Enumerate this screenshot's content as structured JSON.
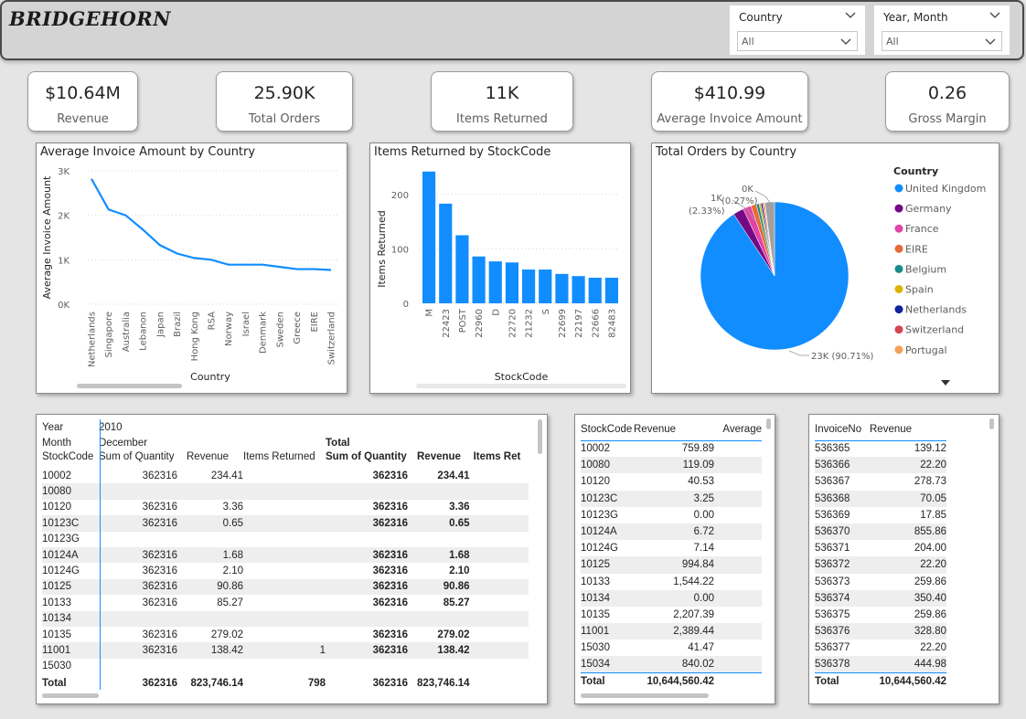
{
  "header": {
    "brand": "BRIDGEHORN",
    "slicers": [
      {
        "label": "Country",
        "value": "All"
      },
      {
        "label": "Year, Month",
        "value": "All"
      }
    ]
  },
  "kpis": [
    {
      "value": "$10.64M",
      "label": "Revenue"
    },
    {
      "value": "25.90K",
      "label": "Total Orders"
    },
    {
      "value": "11K",
      "label": "Items Returned"
    },
    {
      "value": "$410.99",
      "label": "Average Invoice Amount"
    },
    {
      "value": "0.26",
      "label": "Gross Margin"
    }
  ],
  "chart_data": [
    {
      "type": "line",
      "title": "Average Invoice Amount by Country",
      "xlabel": "Country",
      "ylabel": "Average Invoice Amount",
      "ylim": [
        0,
        3000
      ],
      "yticks": [
        "0K",
        "1K",
        "2K",
        "3K"
      ],
      "categories": [
        "Netherlands",
        "Singapore",
        "Australia",
        "Lebanon",
        "Japan",
        "Brazil",
        "Hong Kong",
        "RSA",
        "Norway",
        "Israel",
        "Denmark",
        "Sweden",
        "Greece",
        "EIRE",
        "Switzerland"
      ],
      "values": [
        2820,
        2130,
        2000,
        1680,
        1330,
        1140,
        1040,
        1000,
        890,
        890,
        890,
        840,
        790,
        790,
        770
      ],
      "color": "#118dff"
    },
    {
      "type": "bar",
      "title": "Items Returned by StockCode",
      "xlabel": "StockCode",
      "ylabel": "Items Returned",
      "ylim": [
        0,
        250
      ],
      "yticks": [
        0,
        100,
        200
      ],
      "categories": [
        "M",
        "22423",
        "POST",
        "22960",
        "D",
        "22720",
        "21232",
        "S",
        "22699",
        "22197",
        "22666",
        "82483"
      ],
      "values": [
        242,
        183,
        125,
        86,
        77,
        75,
        62,
        62,
        54,
        50,
        47,
        47
      ],
      "color": "#118dff"
    },
    {
      "type": "pie",
      "title": "Total Orders by Country",
      "legend_title": "Country",
      "legend": [
        {
          "name": "United Kingdom",
          "color": "#118dff"
        },
        {
          "name": "Germany",
          "color": "#750985"
        },
        {
          "name": "France",
          "color": "#e044a7"
        },
        {
          "name": "EIRE",
          "color": "#e66c37"
        },
        {
          "name": "Belgium",
          "color": "#1a8a8a"
        },
        {
          "name": "Spain",
          "color": "#d9b300"
        },
        {
          "name": "Netherlands",
          "color": "#12239e"
        },
        {
          "name": "Switzerland",
          "color": "#d64550"
        },
        {
          "name": "Portugal",
          "color": "#f5a05a"
        }
      ],
      "slices": [
        {
          "name": "United Kingdom",
          "percent": 90.71,
          "color": "#118dff"
        },
        {
          "name": "Germany",
          "percent": 2.33,
          "color": "#750985"
        },
        {
          "name": "France",
          "percent": 1.8,
          "color": "#e044a7"
        },
        {
          "name": "EIRE",
          "percent": 1.2,
          "color": "#e66c37"
        },
        {
          "name": "Belgium",
          "percent": 0.6,
          "color": "#1a8a8a"
        },
        {
          "name": "Spain",
          "percent": 0.4,
          "color": "#d9b300"
        },
        {
          "name": "Netherlands",
          "percent": 0.35,
          "color": "#12239e"
        },
        {
          "name": "Switzerland",
          "percent": 0.27,
          "color": "#d64550"
        },
        {
          "name": "Portugal",
          "percent": 0.25,
          "color": "#f5a05a"
        },
        {
          "name": "Other",
          "percent": 2.09,
          "color": "#a0a0a0"
        }
      ],
      "data_labels": [
        "23K (90.71%)",
        "1K",
        "(2.33%)",
        "0K",
        "(0.27%)"
      ]
    }
  ],
  "matrix": {
    "header_rows": [
      [
        "Year",
        "2010",
        "",
        "",
        "",
        "",
        ""
      ],
      [
        "Month",
        "December",
        "",
        "",
        "Total",
        "",
        ""
      ],
      [
        "StockCode",
        "Sum of Quantity",
        "Revenue",
        "Items Returned",
        "Sum of Quantity",
        "Revenue",
        "Items Ret"
      ]
    ],
    "rows": [
      [
        "10002",
        "362316",
        "234.41",
        "",
        "362316",
        "234.41",
        ""
      ],
      [
        "10080",
        "",
        "",
        "",
        "",
        "",
        ""
      ],
      [
        "10120",
        "362316",
        "3.36",
        "",
        "362316",
        "3.36",
        ""
      ],
      [
        "10123C",
        "362316",
        "0.65",
        "",
        "362316",
        "0.65",
        ""
      ],
      [
        "10123G",
        "",
        "",
        "",
        "",
        "",
        ""
      ],
      [
        "10124A",
        "362316",
        "1.68",
        "",
        "362316",
        "1.68",
        ""
      ],
      [
        "10124G",
        "362316",
        "2.10",
        "",
        "362316",
        "2.10",
        ""
      ],
      [
        "10125",
        "362316",
        "90.86",
        "",
        "362316",
        "90.86",
        ""
      ],
      [
        "10133",
        "362316",
        "85.27",
        "",
        "362316",
        "85.27",
        ""
      ],
      [
        "10134",
        "",
        "",
        "",
        "",
        "",
        ""
      ],
      [
        "10135",
        "362316",
        "279.02",
        "",
        "362316",
        "279.02",
        ""
      ],
      [
        "11001",
        "362316",
        "138.42",
        "1",
        "362316",
        "138.42",
        ""
      ],
      [
        "15030",
        "",
        "",
        "",
        "",
        "",
        ""
      ]
    ],
    "total": [
      "Total",
      "362316",
      "823,746.14",
      "798",
      "362316",
      "823,746.14",
      ""
    ]
  },
  "stock_table": {
    "headers": [
      "StockCode",
      "Revenue",
      "Average"
    ],
    "rows": [
      [
        "10002",
        "759.89"
      ],
      [
        "10080",
        "119.09"
      ],
      [
        "10120",
        "40.53"
      ],
      [
        "10123C",
        "3.25"
      ],
      [
        "10123G",
        "0.00"
      ],
      [
        "10124A",
        "6.72"
      ],
      [
        "10124G",
        "7.14"
      ],
      [
        "10125",
        "994.84"
      ],
      [
        "10133",
        "1,544.22"
      ],
      [
        "10134",
        "0.00"
      ],
      [
        "10135",
        "2,207.39"
      ],
      [
        "11001",
        "2,389.44"
      ],
      [
        "15030",
        "41.47"
      ],
      [
        "15034",
        "840.02"
      ]
    ],
    "total": [
      "Total",
      "10,644,560.42"
    ]
  },
  "invoice_table": {
    "headers": [
      "InvoiceNo",
      "Revenue"
    ],
    "rows": [
      [
        "536365",
        "139.12"
      ],
      [
        "536366",
        "22.20"
      ],
      [
        "536367",
        "278.73"
      ],
      [
        "536368",
        "70.05"
      ],
      [
        "536369",
        "17.85"
      ],
      [
        "536370",
        "855.86"
      ],
      [
        "536371",
        "204.00"
      ],
      [
        "536372",
        "22.20"
      ],
      [
        "536373",
        "259.86"
      ],
      [
        "536374",
        "350.40"
      ],
      [
        "536375",
        "259.86"
      ],
      [
        "536376",
        "328.80"
      ],
      [
        "536377",
        "22.20"
      ],
      [
        "536378",
        "444.98"
      ]
    ],
    "total": [
      "Total",
      "10,644,560.42"
    ]
  }
}
